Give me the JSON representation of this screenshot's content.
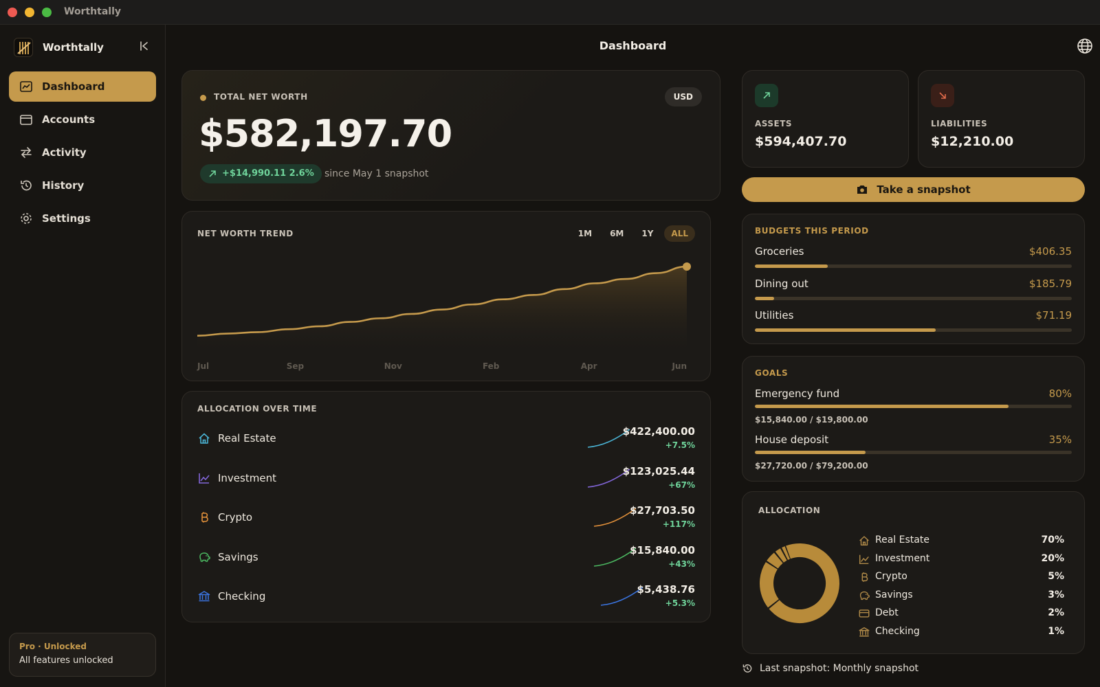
{
  "window": {
    "title": "Worthtally"
  },
  "sidebar": {
    "brand": "Worthtally",
    "items": [
      {
        "label": "Dashboard",
        "icon": "chart-icon",
        "active": true
      },
      {
        "label": "Accounts",
        "icon": "wallet-icon",
        "active": false
      },
      {
        "label": "Activity",
        "icon": "arrows-swap-icon",
        "active": false
      },
      {
        "label": "History",
        "icon": "history-icon",
        "active": false
      },
      {
        "label": "Settings",
        "icon": "gear-icon",
        "active": false
      }
    ],
    "pro": {
      "title": "Pro · Unlocked",
      "subtitle": "All features unlocked"
    }
  },
  "header": {
    "title": "Dashboard"
  },
  "net_worth": {
    "caption": "TOTAL NET WORTH",
    "currency": "USD",
    "value": "$582,197.70",
    "change": "+$14,990.11 2.6%",
    "since": "since May 1 snapshot"
  },
  "trend": {
    "caption": "NET WORTH TREND",
    "ranges": [
      "1M",
      "6M",
      "1Y",
      "ALL"
    ],
    "active_range": "ALL"
  },
  "chart_data": {
    "type": "area",
    "title": "NET WORTH TREND",
    "x_labels": [
      "Jul",
      "Sep",
      "Nov",
      "Feb",
      "Apr",
      "Jun"
    ],
    "values": [
      0.05,
      0.08,
      0.1,
      0.14,
      0.18,
      0.24,
      0.29,
      0.35,
      0.41,
      0.48,
      0.55,
      0.61,
      0.69,
      0.77,
      0.83,
      0.91,
      1.0
    ],
    "value_scale": "relative (no y-axis printed)",
    "grid": false
  },
  "allocation_over_time": {
    "caption": "ALLOCATION OVER TIME",
    "rows": [
      {
        "name": "Real Estate",
        "value": "$422,400.00",
        "change": "+7.5%",
        "icon": "house-icon",
        "color": "#4ab3d4"
      },
      {
        "name": "Investment",
        "value": "$123,025.44",
        "change": "+67%",
        "icon": "line-chart-icon",
        "color": "#8266d9"
      },
      {
        "name": "Crypto",
        "value": "$27,703.50",
        "change": "+117%",
        "icon": "bitcoin-icon",
        "color": "#e08f3a"
      },
      {
        "name": "Savings",
        "value": "$15,840.00",
        "change": "+43%",
        "icon": "piggy-bank-icon",
        "color": "#4cba62"
      },
      {
        "name": "Checking",
        "value": "$5,438.76",
        "change": "+5.3%",
        "icon": "bank-icon",
        "color": "#3a74df"
      }
    ]
  },
  "assets": {
    "caption": "ASSETS",
    "value": "$594,407.70",
    "icon": "arrow-up-right-icon",
    "color": "#6fd39a"
  },
  "liabilities": {
    "caption": "LIABILITIES",
    "value": "$12,210.00",
    "icon": "arrow-down-right-icon",
    "color": "#e06a4a"
  },
  "snapshot_button": {
    "label": "Take a snapshot"
  },
  "budgets": {
    "caption": "BUDGETS THIS PERIOD",
    "items": [
      {
        "name": "Groceries",
        "value": "$406.35",
        "progress": 0.23
      },
      {
        "name": "Dining out",
        "value": "$185.79",
        "progress": 0.06
      },
      {
        "name": "Utilities",
        "value": "$71.19",
        "progress": 0.57
      }
    ]
  },
  "goals": {
    "caption": "GOALS",
    "items": [
      {
        "name": "Emergency fund",
        "percent": "80%",
        "detail": "$15,840.00 / $19,800.00",
        "progress": 0.8
      },
      {
        "name": "House deposit",
        "percent": "35%",
        "detail": "$27,720.00 / $79,200.00",
        "progress": 0.35
      }
    ]
  },
  "allocation": {
    "caption": "ALLOCATION",
    "items": [
      {
        "name": "Real Estate",
        "percent": "70%",
        "share": 70,
        "icon": "house-icon"
      },
      {
        "name": "Investment",
        "percent": "20%",
        "share": 20,
        "icon": "line-chart-icon"
      },
      {
        "name": "Crypto",
        "percent": "5%",
        "share": 5,
        "icon": "bitcoin-icon"
      },
      {
        "name": "Savings",
        "percent": "3%",
        "share": 3,
        "icon": "piggy-bank-icon"
      },
      {
        "name": "Debt",
        "percent": "2%",
        "share": 2,
        "icon": "card-icon"
      },
      {
        "name": "Checking",
        "percent": "1%",
        "share": 1,
        "icon": "bank-icon"
      }
    ],
    "color": "#b88b3a"
  },
  "last_snapshot": "Last snapshot: Monthly snapshot",
  "colors": {
    "accent": "#c59a4c",
    "positive": "#6fd39a",
    "background": "#151310"
  }
}
